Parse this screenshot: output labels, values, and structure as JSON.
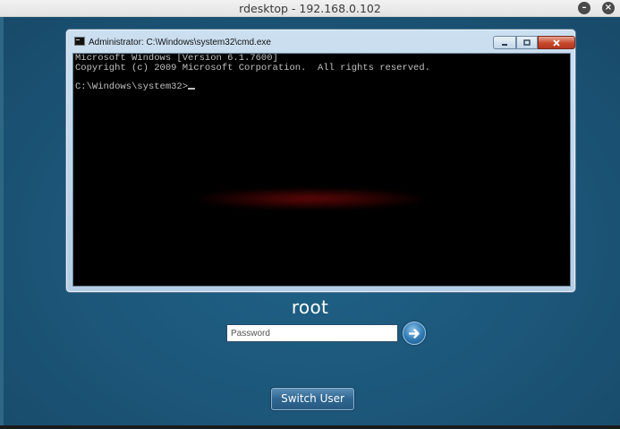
{
  "app": {
    "title": "rdesktop - 192.168.0.102",
    "minimize_icon": "minimize-icon",
    "close_icon": "close-icon"
  },
  "cmd_window": {
    "title": "Administrator: C:\\Windows\\system32\\cmd.exe",
    "icon": "cmd-icon",
    "console_lines": [
      "Microsoft Windows [Version 6.1.7600]",
      "Copyright (c) 2009 Microsoft Corporation.  All rights reserved.",
      "",
      "C:\\Windows\\system32>"
    ],
    "buttons": {
      "minimize": "minimize-icon",
      "maximize": "maximize-icon",
      "close": "close-icon"
    }
  },
  "login": {
    "username": "root",
    "password_placeholder": "Password",
    "submit_icon": "arrow-right-icon",
    "switch_user_label": "Switch User"
  },
  "colors": {
    "desktop_background": "#1b5272",
    "console_background": "#000000",
    "console_text": "#c0c0c0"
  }
}
